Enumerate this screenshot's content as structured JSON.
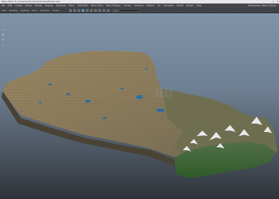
{
  "window": {
    "title": "Maya 2018: D:/_projects/real_terrain/scenes/terrain.ma*",
    "controls": [
      "–",
      "□",
      "✕"
    ]
  },
  "menubar": {
    "items": [
      "File",
      "Edit",
      "Create",
      "Select",
      "Modify",
      "Display",
      "Windows",
      "Mesh",
      "Edit Mesh",
      "Mesh Tools",
      "Mesh Display",
      "Curves",
      "Surfaces",
      "Deform",
      "UV",
      "Generate",
      "Cache",
      "Arnold",
      "Help"
    ],
    "workspace": "Workspace: Maya Classic"
  },
  "viewbar": {
    "menus": [
      "View",
      "Shading",
      "Lighting",
      "Show",
      "Renderer",
      "Panels"
    ],
    "camera_field": "persp"
  },
  "sidetools": [
    "↖",
    "✥",
    "⟳",
    "⤢"
  ],
  "terrain": {
    "colors": {
      "plateau": "#8a7a5c",
      "ridges": "#6e6048",
      "lakes": "#2e6ea0",
      "forest": "#3f6b35",
      "snow": "#e7e9ea"
    }
  }
}
